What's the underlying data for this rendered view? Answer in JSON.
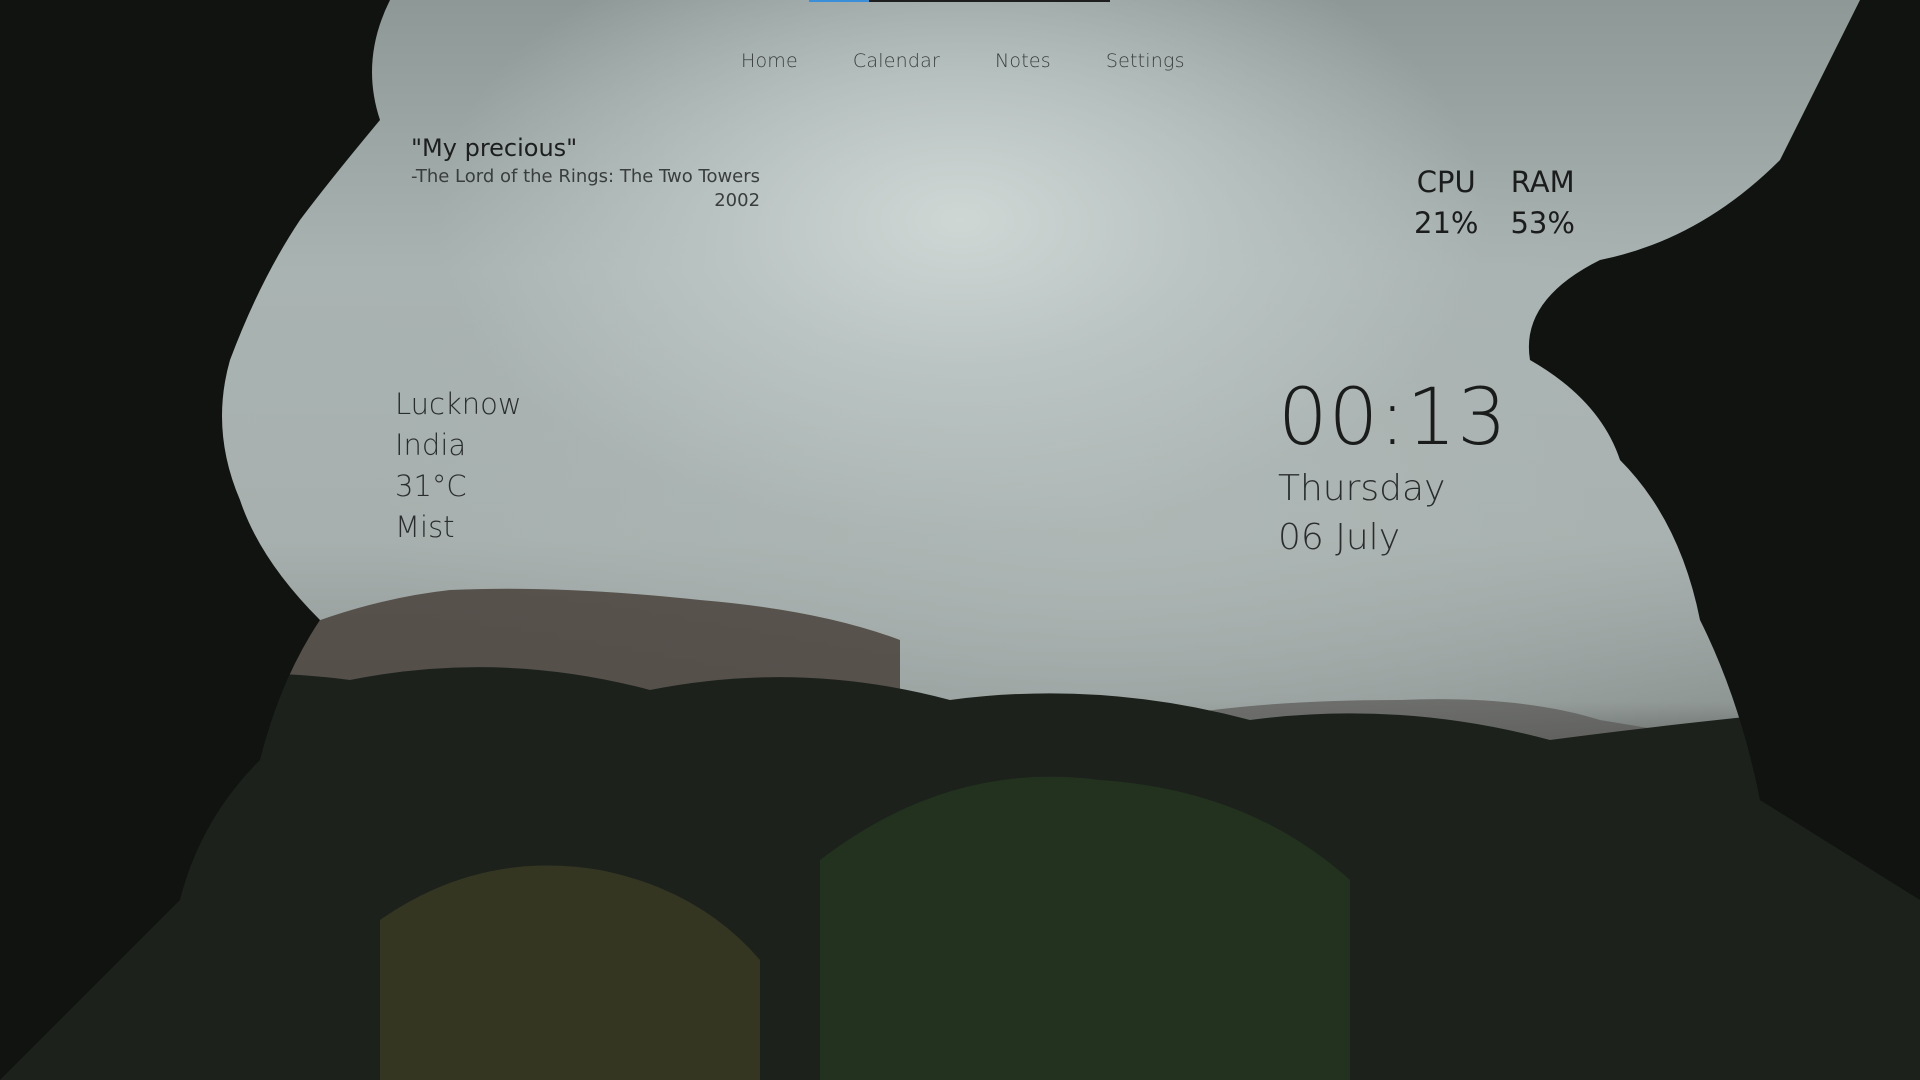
{
  "progress": {
    "value_percent": 20,
    "fill_color": "#3a8fd8",
    "track_color": "#1e1e1e"
  },
  "nav": {
    "items": [
      {
        "label": "Home"
      },
      {
        "label": "Calendar"
      },
      {
        "label": "Notes"
      },
      {
        "label": "Settings"
      }
    ]
  },
  "quote": {
    "text": "\"My precious\"",
    "source": "-The Lord of the Rings: The Two Towers",
    "year": "2002"
  },
  "system": {
    "cpu_label": "CPU",
    "cpu_value": "21%",
    "ram_label": "RAM",
    "ram_value": "53%"
  },
  "weather": {
    "city": "Lucknow",
    "country": "India",
    "temperature": "31°C",
    "condition": "Mist"
  },
  "clock": {
    "time": "00:13",
    "day": "Thursday",
    "date": "06 July"
  },
  "background": {
    "description": "misty forest landscape with hills and trees",
    "sky_color": "#b7c0be",
    "tree_color": "#111412"
  }
}
